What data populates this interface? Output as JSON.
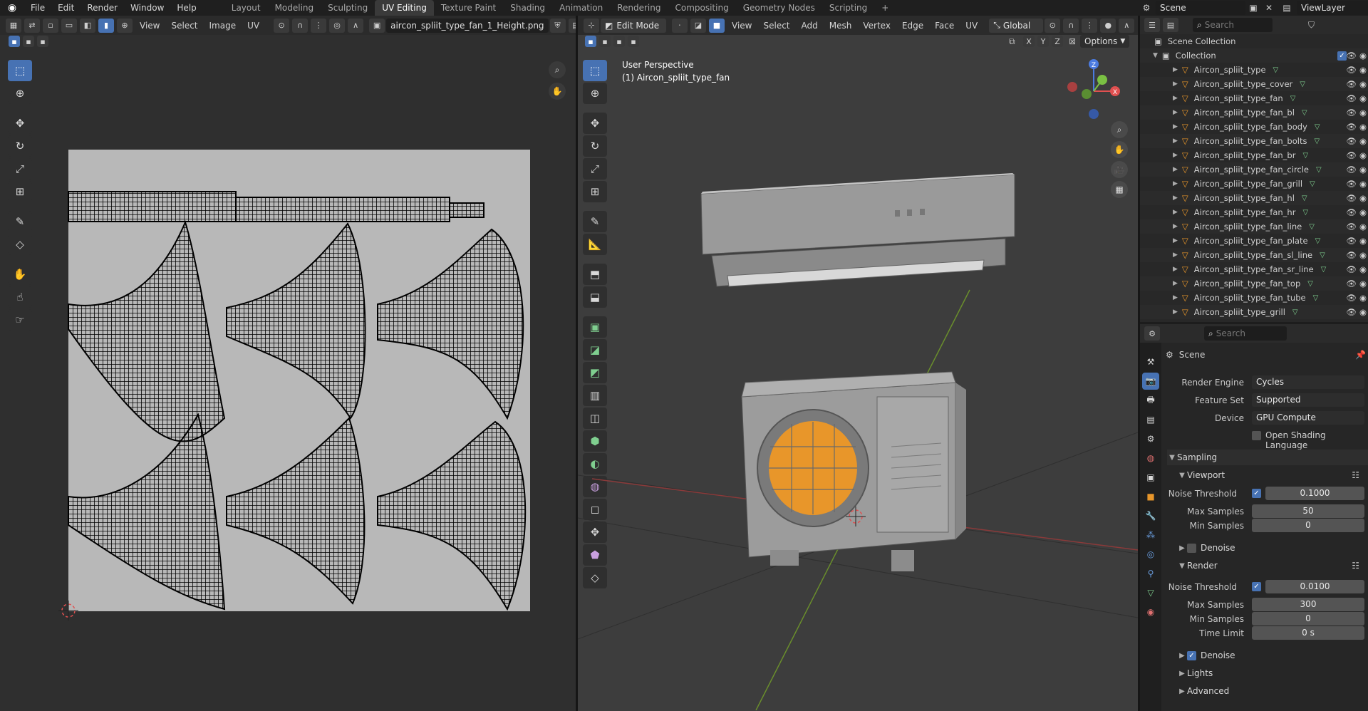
{
  "topbar": {
    "menus": [
      "File",
      "Edit",
      "Render",
      "Window",
      "Help"
    ],
    "workspaces": [
      "Layout",
      "Modeling",
      "Sculpting",
      "UV Editing",
      "Texture Paint",
      "Shading",
      "Animation",
      "Rendering",
      "Compositing",
      "Geometry Nodes",
      "Scripting"
    ],
    "active_workspace": "UV Editing",
    "add_tab": "+",
    "scene": "Scene",
    "view_layer": "ViewLayer"
  },
  "uv_editor": {
    "menus": [
      "View",
      "Select",
      "Image",
      "UV"
    ],
    "image_name": "aircon_spliit_type_fan_1_Height.png"
  },
  "viewport": {
    "mode": "Edit Mode",
    "menus": [
      "View",
      "Select",
      "Add",
      "Mesh",
      "Vertex",
      "Edge",
      "Face",
      "UV"
    ],
    "orientation": "Global",
    "options_label": "Options",
    "axes": [
      "X",
      "Y",
      "Z"
    ],
    "overlay_title": "User Perspective",
    "overlay_object": "(1) Aircon_spliit_type_fan"
  },
  "outliner": {
    "search_placeholder": "Search",
    "scene_collection": "Scene Collection",
    "collection": "Collection",
    "items": [
      "Aircon_spliit_type",
      "Aircon_spliit_type_cover",
      "Aircon_spliit_type_fan",
      "Aircon_spliit_type_fan_bl",
      "Aircon_spliit_type_fan_body",
      "Aircon_spliit_type_fan_bolts",
      "Aircon_spliit_type_fan_br",
      "Aircon_spliit_type_fan_circle",
      "Aircon_spliit_type_fan_grill",
      "Aircon_spliit_type_fan_hl",
      "Aircon_spliit_type_fan_hr",
      "Aircon_spliit_type_fan_line",
      "Aircon_spliit_type_fan_plate",
      "Aircon_spliit_type_fan_sl_line",
      "Aircon_spliit_type_fan_sr_line",
      "Aircon_spliit_type_fan_top",
      "Aircon_spliit_type_fan_tube",
      "Aircon_spliit_type_grill"
    ]
  },
  "properties": {
    "search_placeholder": "Search",
    "context": "Scene",
    "render_engine_label": "Render Engine",
    "render_engine": "Cycles",
    "feature_set_label": "Feature Set",
    "feature_set": "Supported",
    "device_label": "Device",
    "device": "GPU Compute",
    "osl_label": "Open Shading Language",
    "sampling": "Sampling",
    "viewport": "Viewport",
    "noise_threshold_label": "Noise Threshold",
    "vp_noise_threshold": "0.1000",
    "max_samples_label": "Max Samples",
    "vp_max_samples": "50",
    "min_samples_label": "Min Samples",
    "vp_min_samples": "0",
    "denoise_label": "Denoise",
    "render": "Render",
    "r_noise_threshold": "0.0100",
    "r_max_samples": "300",
    "r_min_samples": "0",
    "time_limit_label": "Time Limit",
    "r_time_limit": "0 s",
    "lights": "Lights",
    "advanced": "Advanced"
  }
}
